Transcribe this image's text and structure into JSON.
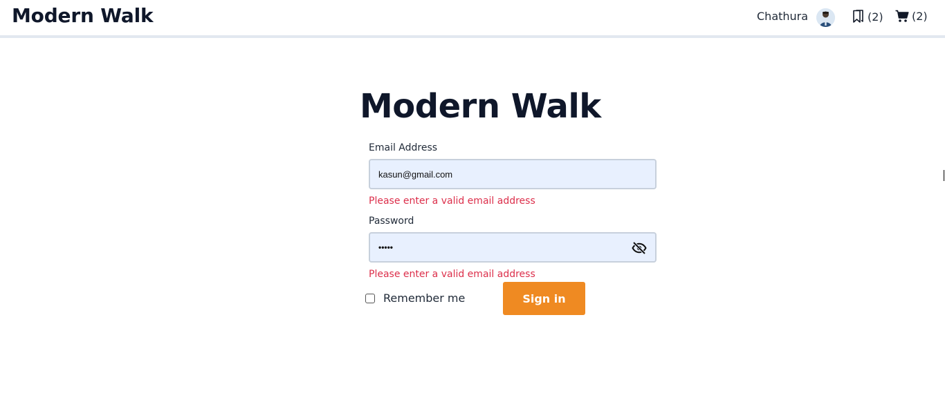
{
  "header": {
    "brand": "Modern Walk",
    "user_name": "Chathura",
    "saved_count": "(2)",
    "cart_count": "(2)"
  },
  "form": {
    "title": "Modern Walk",
    "email": {
      "label": "Email Address",
      "value": "kasun@gmail.com",
      "error": "Please enter a valid email address"
    },
    "password": {
      "label": "Password",
      "value": "•••••",
      "error": "Please enter a valid email address"
    },
    "remember_label": "Remember me",
    "submit_label": "Sign in"
  },
  "icons": {
    "avatar": "user-avatar",
    "saved": "bookmark-icon",
    "cart": "cart-icon",
    "password_toggle": "eye-slash-icon",
    "remember": "checkbox"
  },
  "colors": {
    "accent": "#ef8a22",
    "error": "#dc2e4a",
    "input_bg": "#e8f0fe",
    "title": "#0f172a"
  }
}
